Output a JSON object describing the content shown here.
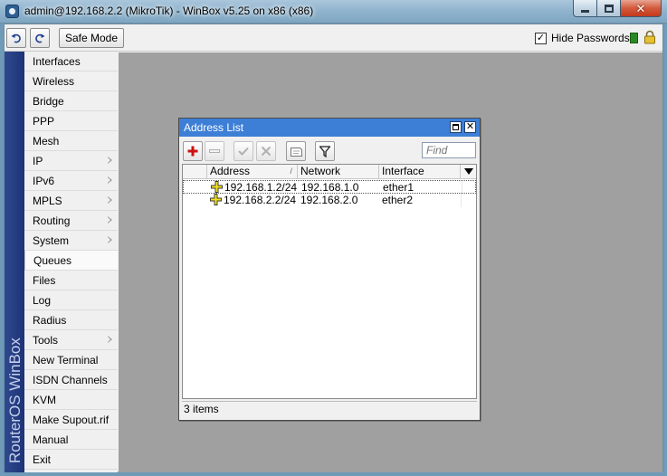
{
  "window": {
    "title": "admin@192.168.2.2 (MikroTik) - WinBox v5.25 on x86 (x86)"
  },
  "toolbar": {
    "safe_mode_label": "Safe Mode",
    "hide_passwords_label": "Hide Passwords",
    "hide_passwords_checked": true
  },
  "sidebar": {
    "brand": "RouterOS WinBox",
    "items": [
      {
        "label": "Interfaces",
        "submenu": false
      },
      {
        "label": "Wireless",
        "submenu": false
      },
      {
        "label": "Bridge",
        "submenu": false
      },
      {
        "label": "PPP",
        "submenu": false
      },
      {
        "label": "Mesh",
        "submenu": false
      },
      {
        "label": "IP",
        "submenu": true
      },
      {
        "label": "IPv6",
        "submenu": true
      },
      {
        "label": "MPLS",
        "submenu": true
      },
      {
        "label": "Routing",
        "submenu": true
      },
      {
        "label": "System",
        "submenu": true
      },
      {
        "label": "Queues",
        "submenu": false
      },
      {
        "label": "Files",
        "submenu": false
      },
      {
        "label": "Log",
        "submenu": false
      },
      {
        "label": "Radius",
        "submenu": false
      },
      {
        "label": "Tools",
        "submenu": true
      },
      {
        "label": "New Terminal",
        "submenu": false
      },
      {
        "label": "ISDN Channels",
        "submenu": false
      },
      {
        "label": "KVM",
        "submenu": false
      },
      {
        "label": "Make Supout.rif",
        "submenu": false
      },
      {
        "label": "Manual",
        "submenu": false
      },
      {
        "label": "Exit",
        "submenu": false
      }
    ]
  },
  "address_list": {
    "title": "Address List",
    "find_placeholder": "Find",
    "columns": [
      "Address",
      "Network",
      "Interface"
    ],
    "rows": [
      {
        "address": "192.168.1.2/24",
        "network": "192.168.1.0",
        "interface": "ether1"
      },
      {
        "address": "192.168.2.2/24",
        "network": "192.168.2.0",
        "interface": "ether2"
      }
    ],
    "status": "3 items"
  },
  "colors": {
    "window_title_bg": "#3d7fd6",
    "brand_bg": "#1d3276",
    "workspace_bg": "#a0a0a0",
    "add_icon": "#cc1111",
    "status_green": "#2a8a22"
  }
}
